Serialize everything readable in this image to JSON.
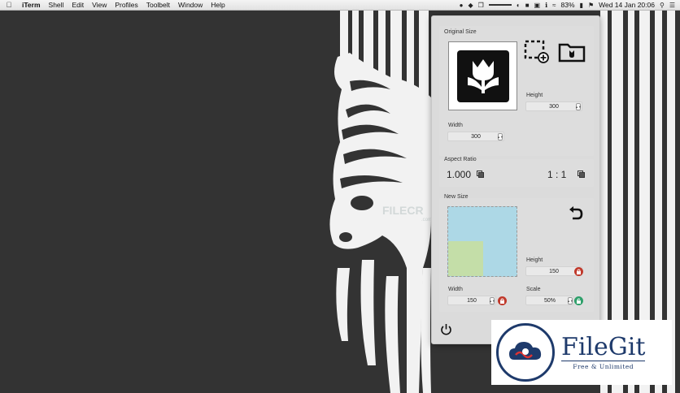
{
  "menubar": {
    "app_name": "iTerm",
    "menus": [
      "Shell",
      "Edit",
      "View",
      "Profiles",
      "Toolbelt",
      "Window",
      "Help"
    ],
    "battery": "83%",
    "clock": "Wed 14 Jan  20:06"
  },
  "panel": {
    "original_size": {
      "label": "Original Size",
      "height_label": "Height",
      "height_value": "300",
      "width_label": "Width",
      "width_value": "300"
    },
    "aspect_ratio": {
      "label": "Aspect Ratio",
      "decimal_value": "1.000",
      "ratio_value": "1 : 1"
    },
    "new_size": {
      "label": "New Size",
      "height_label": "Height",
      "height_value": "150",
      "width_label": "Width",
      "width_value": "150",
      "scale_label": "Scale",
      "scale_value": "50%",
      "preview_colors": {
        "outer": "#add8e6",
        "inner": "#c4dea8"
      }
    }
  },
  "wallpaper": {
    "watermark_text": "FILECR",
    "watermark_sub": ".com"
  },
  "badge": {
    "title": "FileGit",
    "subtitle": "Free & Unlimited",
    "brand_color": "#1e3a6b"
  },
  "icons": [
    "apple-icon",
    "tulip-icon",
    "add-selection-icon",
    "folder-icon",
    "undo-icon",
    "power-icon",
    "copy-icon",
    "lock-icon"
  ]
}
